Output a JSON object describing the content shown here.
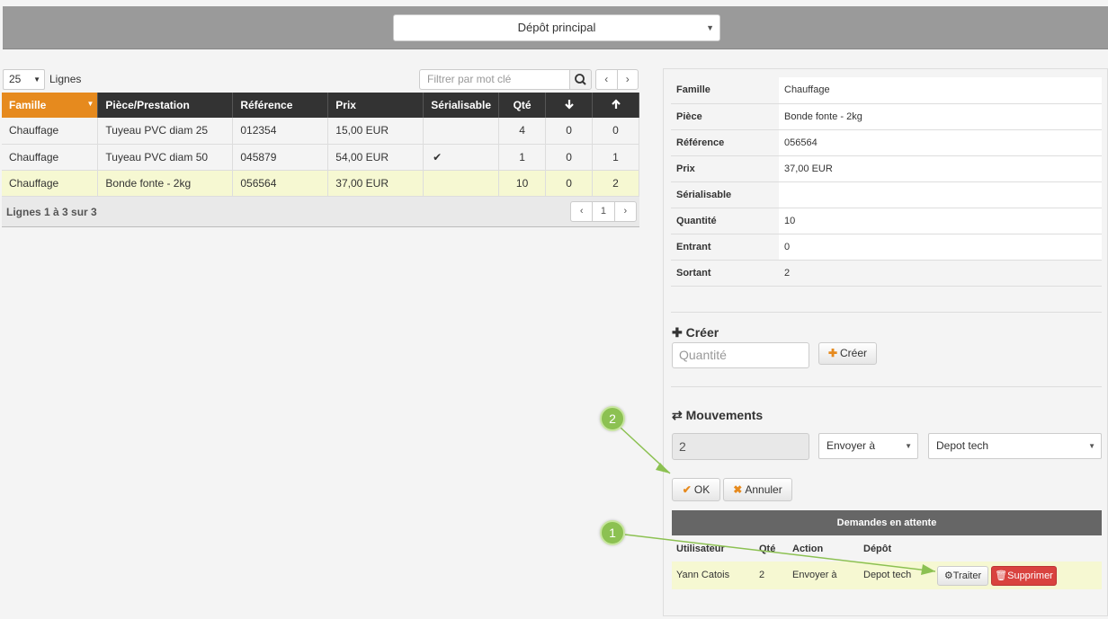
{
  "depot": {
    "selected": "Dépôt principal"
  },
  "list": {
    "page_length": "25",
    "page_length_label": "Lignes",
    "filter_placeholder": "Filtrer par mot clé",
    "columns": [
      "Famille",
      "Pièce/Prestation",
      "Référence",
      "Prix",
      "Sérialisable",
      "Qté"
    ],
    "rows": [
      {
        "famille": "Chauffage",
        "piece": "Tuyeau PVC diam 25",
        "ref": "012354",
        "prix": "15,00 EUR",
        "serial": "",
        "qte": "4",
        "in": "0",
        "out": "0"
      },
      {
        "famille": "Chauffage",
        "piece": "Tuyeau PVC diam 50",
        "ref": "045879",
        "prix": "54,00 EUR",
        "serial": "✔",
        "qte": "1",
        "in": "0",
        "out": "1"
      },
      {
        "famille": "Chauffage",
        "piece": "Bonde fonte - 2kg",
        "ref": "056564",
        "prix": "37,00 EUR",
        "serial": "",
        "qte": "10",
        "in": "0",
        "out": "2"
      }
    ],
    "info": "Lignes 1 à 3 sur 3",
    "page": "1"
  },
  "detail": {
    "labels": [
      "Famille",
      "Pièce",
      "Référence",
      "Prix",
      "Sérialisable",
      "Quantité",
      "Entrant",
      "Sortant"
    ],
    "values": [
      "Chauffage",
      "Bonde fonte - 2kg",
      "056564",
      "37,00 EUR",
      "",
      "10",
      "0",
      "2"
    ]
  },
  "create": {
    "title": "Créer",
    "qty_placeholder": "Quantité",
    "button": "Créer"
  },
  "moves": {
    "title": "Mouvements",
    "qty_value": "2",
    "action": "Envoyer à",
    "target": "Depot tech",
    "ok": "OK",
    "cancel": "Annuler"
  },
  "pending": {
    "title": "Demandes en attente",
    "columns": [
      "Utilisateur",
      "Qté",
      "Action",
      "Dépôt"
    ],
    "row": {
      "user": "Yann Catois",
      "qty": "2",
      "action": "Envoyer à",
      "depot": "Depot tech"
    },
    "process": "Traiter",
    "delete": "Supprimer"
  },
  "annotations": [
    "1",
    "2"
  ],
  "colors": {
    "accent": "#e68a1e",
    "header": "#333333",
    "highlight": "#f6f8d2",
    "danger": "#d9433f",
    "bubble": "#8cc152"
  }
}
